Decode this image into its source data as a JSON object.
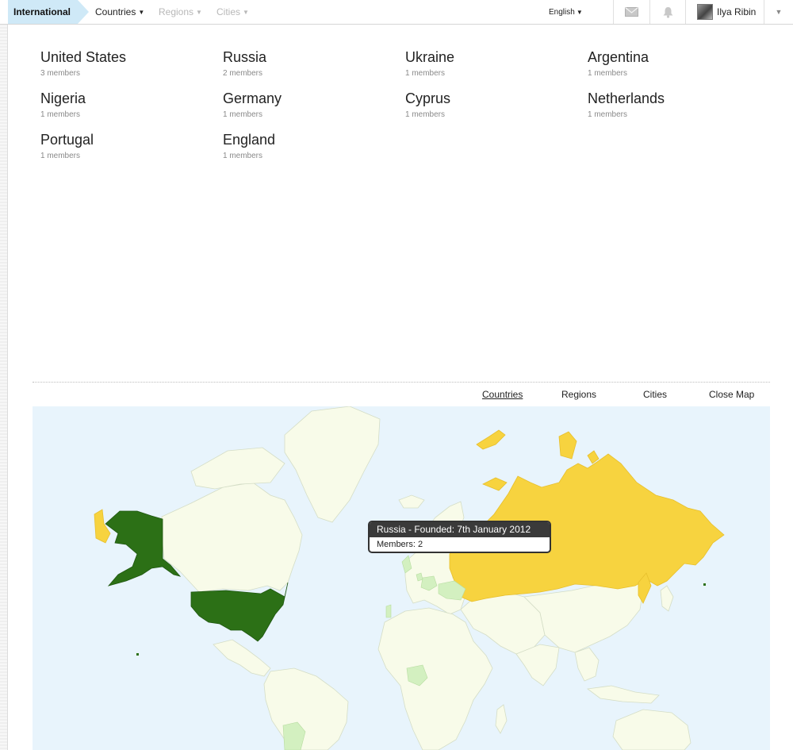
{
  "topbar": {
    "breadcrumb": "International",
    "nav": [
      {
        "label": "Countries",
        "state": "active"
      },
      {
        "label": "Regions",
        "state": "disabled"
      },
      {
        "label": "Cities",
        "state": "disabled"
      }
    ],
    "language": "English",
    "icons": {
      "messages": "envelope-icon",
      "notifications": "bell-icon",
      "menu": "chevron-down-icon"
    },
    "user": {
      "name": "Ilya Ribin"
    }
  },
  "countries": [
    {
      "name": "United States",
      "members": "3 members"
    },
    {
      "name": "Russia",
      "members": "2 members"
    },
    {
      "name": "Ukraine",
      "members": "1 members"
    },
    {
      "name": "Argentina",
      "members": "1 members"
    },
    {
      "name": "Nigeria",
      "members": "1 members"
    },
    {
      "name": "Germany",
      "members": "1 members"
    },
    {
      "name": "Cyprus",
      "members": "1 members"
    },
    {
      "name": "Netherlands",
      "members": "1 members"
    },
    {
      "name": "Portugal",
      "members": "1 members"
    },
    {
      "name": "England",
      "members": "1 members"
    }
  ],
  "map_tabs": [
    {
      "label": "Countries",
      "selected": true
    },
    {
      "label": "Regions",
      "selected": false
    },
    {
      "label": "Cities",
      "selected": false
    },
    {
      "label": "Close Map",
      "selected": false
    }
  ],
  "map": {
    "colors": {
      "ocean": "#e8f4fc",
      "land": "#f8fbe9",
      "border": "#d4ddc6",
      "highlight_dark": "#2c7016",
      "highlight_yellow": "#f7d33f",
      "highlight_light": "#d3f0c0"
    },
    "tooltip": {
      "title": "Russia - Founded: 7th January 2012",
      "body": "Members: 2"
    }
  }
}
